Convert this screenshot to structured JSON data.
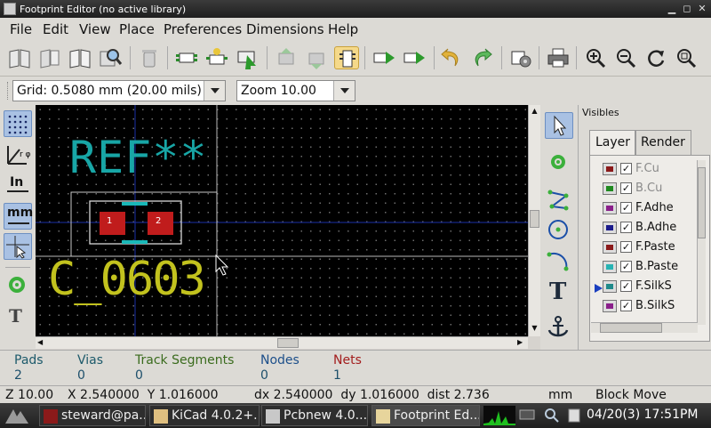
{
  "window": {
    "title": "Footprint Editor (no active library)"
  },
  "menu": [
    "File",
    "Edit",
    "View",
    "Place",
    "Preferences",
    "Dimensions",
    "Help"
  ],
  "toolbar": {
    "icons": [
      "open-library-icon",
      "new-library-icon",
      "library-book-icon",
      "search-library-icon",
      "delete-icon",
      "new-footprint-icon",
      "footprint-wizard-icon",
      "load-footprint-icon",
      "import-footprint-icon",
      "export-footprint-icon",
      "module-icon",
      "load-from-board-icon",
      "insert-to-board-icon",
      "undo-icon",
      "redo-icon",
      "footprint-properties-icon",
      "print-icon",
      "zoom-in-icon",
      "zoom-out-icon",
      "redraw-icon",
      "zoom-fit-icon"
    ]
  },
  "grid": {
    "selected": "Grid: 0.5080 mm (20.00 mils)"
  },
  "zoom": {
    "selected": "Zoom 10.00"
  },
  "left_tools": {
    "units_in_label": "In",
    "units_mm_label": "mm"
  },
  "canvas": {
    "ref_text": "REF**",
    "value_text": "C_0603",
    "pad1": "1",
    "pad2": "2"
  },
  "visibles": {
    "title": "Visibles",
    "tab_layer": "Layer",
    "tab_render": "Render",
    "layers": [
      {
        "name": "F.Cu",
        "color": "#8b1a1a",
        "checked": "✓",
        "dimmed": true
      },
      {
        "name": "B.Cu",
        "color": "#1f8a1f",
        "checked": "✓",
        "dimmed": true
      },
      {
        "name": "F.Adhe",
        "color": "#8a1f8a",
        "checked": "✓",
        "dimmed": false
      },
      {
        "name": "B.Adhe",
        "color": "#1a1a8b",
        "checked": "✓",
        "dimmed": false
      },
      {
        "name": "F.Paste",
        "color": "#8b1a1a",
        "checked": "✓",
        "dimmed": false
      },
      {
        "name": "B.Paste",
        "color": "#27b3b3",
        "checked": "✓",
        "dimmed": false
      },
      {
        "name": "F.SilkS",
        "color": "#1f8a8a",
        "checked": "✓",
        "dimmed": false
      },
      {
        "name": "B.SilkS",
        "color": "#8a1f8a",
        "checked": "✓",
        "dimmed": false
      }
    ]
  },
  "stats": {
    "pads_label": "Pads",
    "pads_value": "2",
    "vias_label": "Vias",
    "vias_value": "0",
    "tracks_label": "Track Segments",
    "tracks_value": "0",
    "nodes_label": "Nodes",
    "nodes_value": "0",
    "nets_label": "Nets",
    "nets_value": "1"
  },
  "status": {
    "zoom": "Z 10.00",
    "xy": "X 2.540000  Y 1.016000",
    "dxdy": "dx 2.540000  dy 1.016000  dist 2.736",
    "units": "mm",
    "mode": "Block Move"
  },
  "taskbar": {
    "tasks": [
      "steward@pa...",
      "KiCad 4.0.2+...",
      "Pcbnew 4.0....",
      "Footprint Ed..."
    ],
    "clock": "04/20(3) 17:51PM"
  }
}
